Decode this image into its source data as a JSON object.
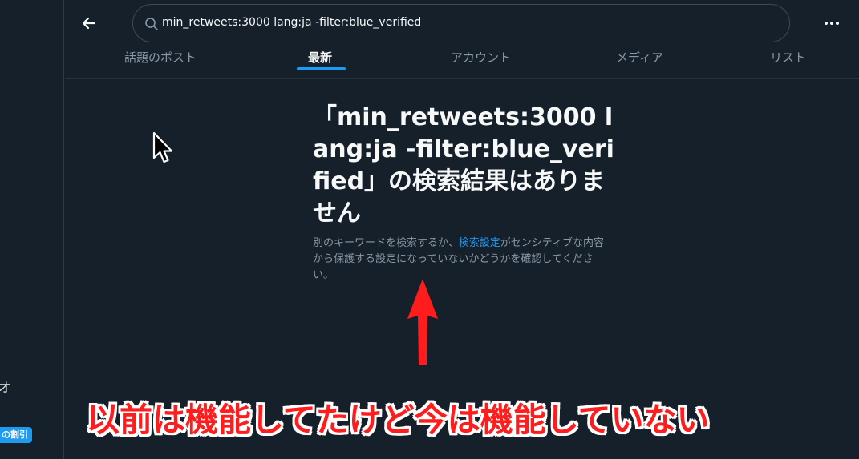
{
  "search": {
    "query": "min_retweets:3000 lang:ja -filter:blue_verified"
  },
  "tabs": [
    {
      "label": "話題のポスト"
    },
    {
      "label": "最新"
    },
    {
      "label": "アカウント"
    },
    {
      "label": "メディア"
    },
    {
      "label": "リスト"
    }
  ],
  "empty_state": {
    "title": "「min_retweets:3000 lang:ja -filter:blue_verified」の検索結果はありません",
    "description_before": "別のキーワードを検索するか、",
    "description_link": "検索設定",
    "description_after": "がセンシティブな内容から保護する設定になっていないかどうかを確認してください。"
  },
  "left_rail": {
    "fragment_text": "オ",
    "badge_text": "の割引"
  },
  "annotation": {
    "text": "以前は機能してたけど今は機能していない"
  },
  "icons": {
    "back": "arrow-left-icon",
    "search": "magnifier-icon",
    "more": "ellipsis-icon",
    "cursor": "mouse-pointer-icon",
    "annotation_arrow": "red-up-arrow-icon"
  },
  "colors": {
    "background": "#15202b",
    "accent": "#1d9bf0",
    "annotation": "#ff1c1c"
  }
}
